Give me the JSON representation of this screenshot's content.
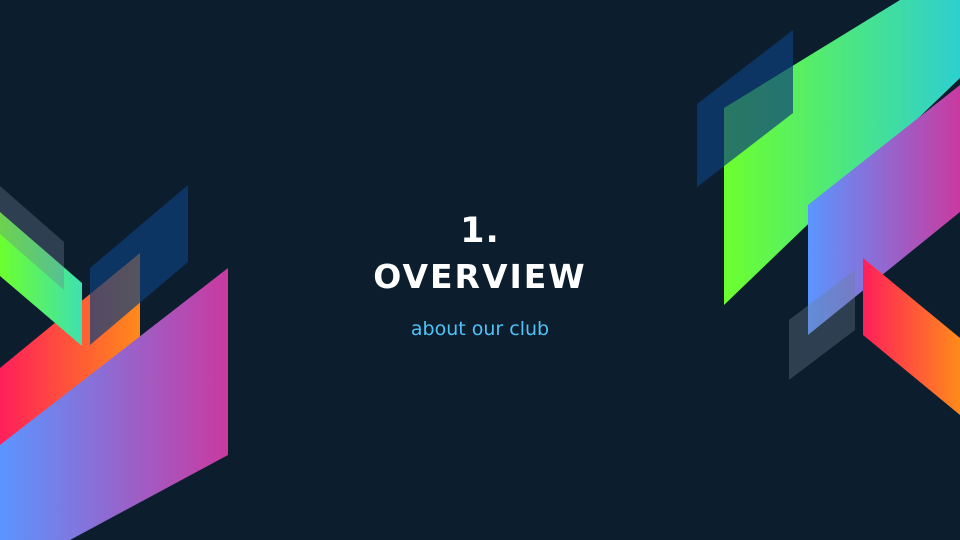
{
  "slide": {
    "number": "1.",
    "title": "OVERVIEW",
    "subtitle": "about our club"
  },
  "colors": {
    "background": "#0c1e2e",
    "subtitle": "#4fc3f7",
    "title": "#ffffff",
    "gradient_green": [
      "#6cff2e",
      "#2ecfd0"
    ],
    "gradient_purple": [
      "#5b95ff",
      "#c93aa0"
    ],
    "gradient_red": [
      "#ff1f5a",
      "#ff8a1a"
    ],
    "navy_overlay": "#0d3f7a",
    "grey_overlay": "#6d7f8e"
  }
}
